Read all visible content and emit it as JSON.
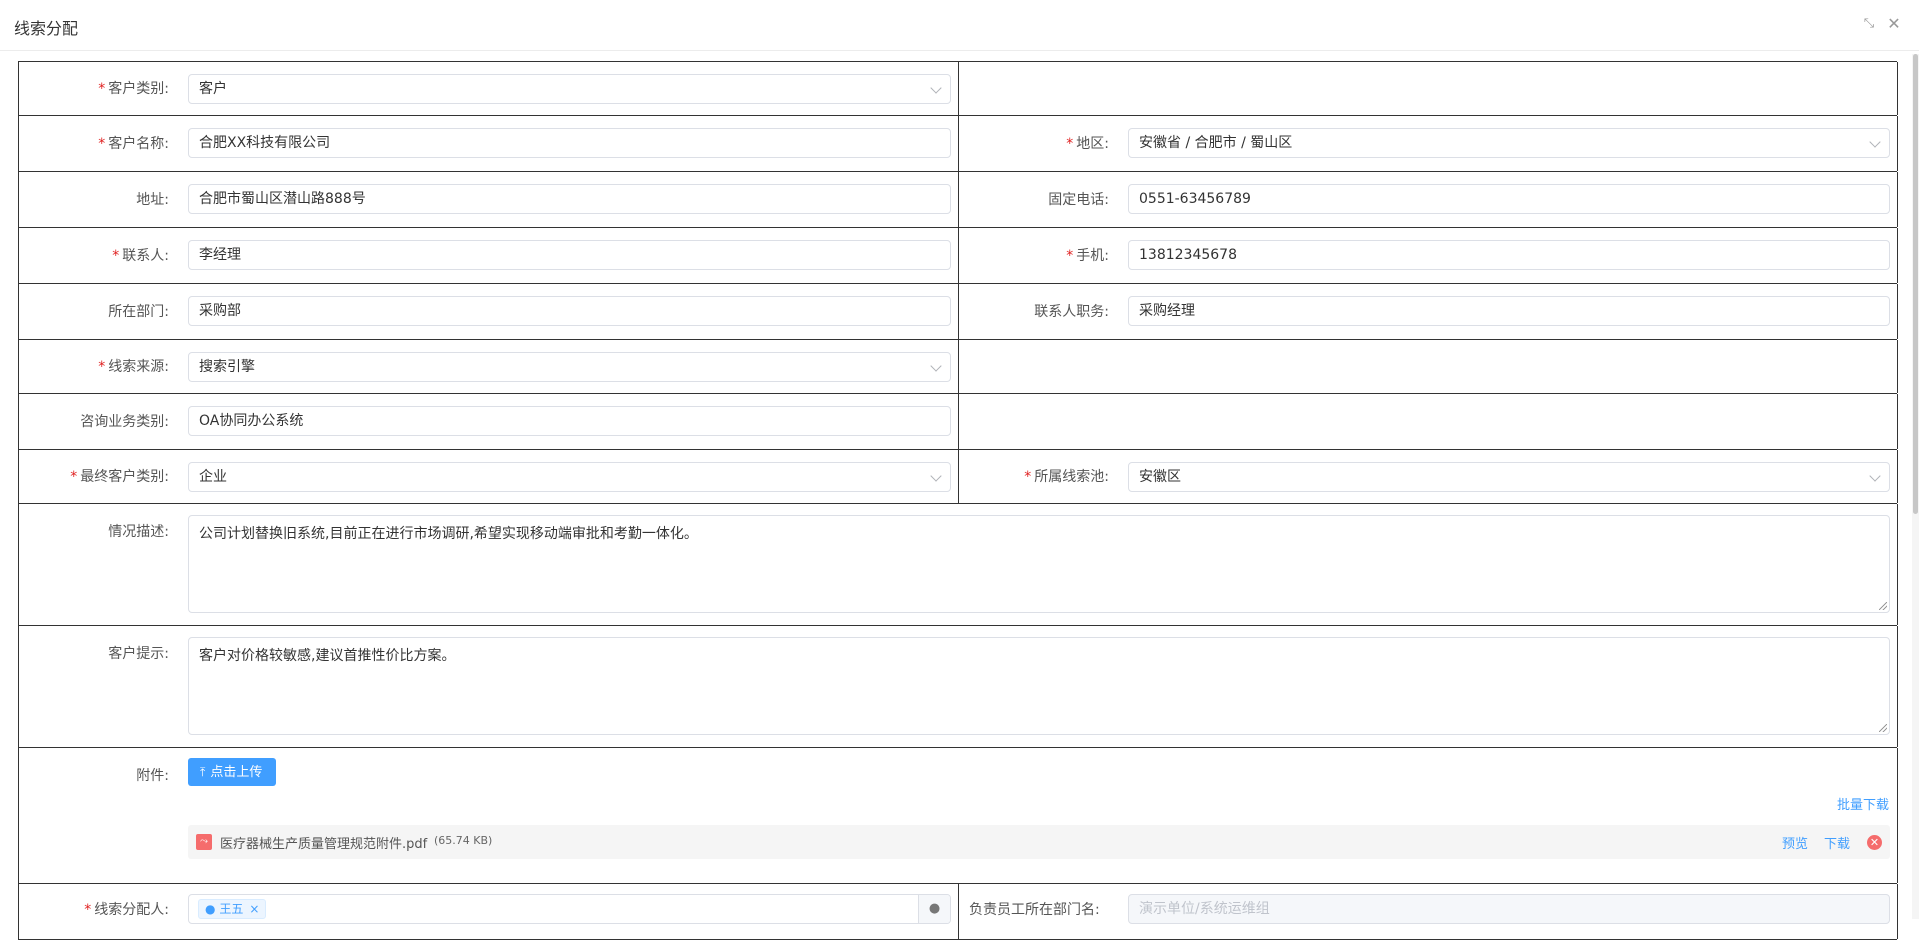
{
  "window": {
    "title": "线索分配",
    "shrink_icon": "shrink-icon",
    "close_icon": "close-icon"
  },
  "form": {
    "customer_type": {
      "label": "客户类别:",
      "value": "客户",
      "required": true
    },
    "customer_name": {
      "label": "客户名称:",
      "value": "合肥XX科技有限公司",
      "required": true
    },
    "region": {
      "label": "地区:",
      "value": "安徽省 / 合肥市 / 蜀山区",
      "required": true
    },
    "address": {
      "label": "地址:",
      "value": "合肥市蜀山区潜山路888号"
    },
    "phone": {
      "label": "固定电话:",
      "value": "0551-63456789"
    },
    "contact": {
      "label": "联系人:",
      "value": "李经理",
      "required": true
    },
    "mobile": {
      "label": "手机:",
      "value": "13812345678",
      "required": true
    },
    "department": {
      "label": "所在部门:",
      "value": "采购部"
    },
    "contact_title": {
      "label": "联系人职务:",
      "value": "采购经理"
    },
    "lead_source": {
      "label": "线索来源:",
      "value": "搜索引擎",
      "required": true
    },
    "consult_type": {
      "label": "咨询业务类别:",
      "value": "OA协同办公系统"
    },
    "final_customer_type": {
      "label": "最终客户类别:",
      "value": "企业",
      "required": true
    },
    "lead_pool": {
      "label": "所属线索池:",
      "value": "安徽区",
      "required": true
    },
    "situation": {
      "label": "情况描述:",
      "value": "公司计划替换旧系统,目前正在进行市场调研,希望实现移动端审批和考勤一体化。"
    },
    "customer_tip": {
      "label": "客户提示:",
      "value": "客户对价格较敏感,建议首推性价比方案。"
    },
    "attachment": {
      "label": "附件:",
      "upload_label": "点击上传",
      "batch_download": "批量下载",
      "file_name": "医疗器械生产质量管理规范附件.pdf",
      "file_size": "(65.74 KB)",
      "preview": "预览",
      "download": "下载"
    },
    "assigner": {
      "label": "线索分配人:",
      "tag": "王五",
      "required": true
    },
    "owner_dept": {
      "label": "负责员工所在部门名:",
      "placeholder": "演示单位/系统运维组"
    }
  }
}
